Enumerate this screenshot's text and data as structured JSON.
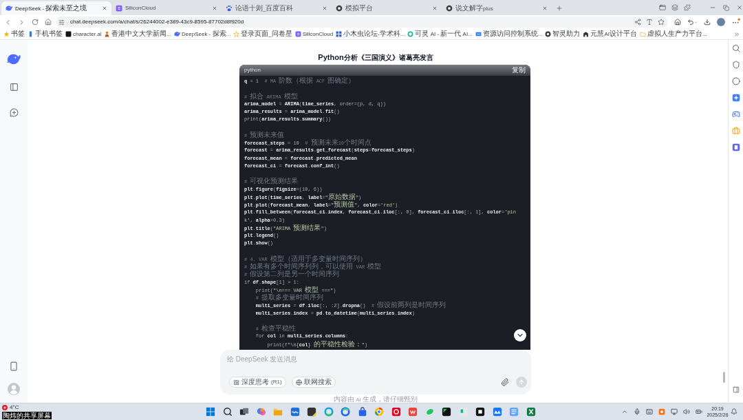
{
  "browser": {
    "tabs": [
      {
        "title": "DeepSeek - 探索未至之境",
        "selected": true
      },
      {
        "title": "SiliconCloud",
        "selected": false
      },
      {
        "title": "论语十则_百度百科",
        "selected": false
      },
      {
        "title": "模拟平台",
        "selected": false
      },
      {
        "title": "说文解字plus",
        "selected": false
      }
    ],
    "url": "chat.deepseek.com/a/chat/s/26244002-e389-43c9-8595-87702d8f920d",
    "bookmarks": [
      "书签",
      "手机书签",
      "character.ai",
      "香港中文大学新闻...",
      "DeepSeek - 探索...",
      "登录页面_问卷星",
      "SiliconCloud",
      "小木虫论坛-学术科...",
      "可灵 AI - 新一代 AI...",
      "资源访问控制系统...",
      "智灵助力",
      "元慧AI设计平台",
      "虚拟人生产力平台..."
    ]
  },
  "chat": {
    "title": "Python分析《三国演义》诸葛亮发言",
    "code_block": {
      "language": "python",
      "copy_label": "复制",
      "blocks": [
        [
          [
            {
              "kind": "name",
              "text": "q"
            },
            {
              "kind": "punct",
              "text": " = 1  "
            },
            {
              "kind": "comment",
              "text": "# MA 阶数（根据 ACF 图确定）"
            }
          ]
        ],
        [
          [
            {
              "kind": "comment",
              "text": "# 拟合 ARIMA 模型"
            }
          ],
          [
            {
              "kind": "name",
              "text": "arima_model"
            },
            {
              "kind": "punct",
              "text": " = "
            },
            {
              "kind": "name",
              "text": "ARIMA"
            },
            {
              "kind": "punct",
              "text": "("
            },
            {
              "kind": "name",
              "text": "time_series"
            },
            {
              "kind": "punct",
              "text": ", order=(p, d, q))"
            }
          ],
          [
            {
              "kind": "name",
              "text": "arima_results"
            },
            {
              "kind": "punct",
              "text": " = "
            },
            {
              "kind": "name",
              "text": "arima_model"
            },
            {
              "kind": "punct",
              "text": "."
            },
            {
              "kind": "name",
              "text": "fit"
            },
            {
              "kind": "punct",
              "text": "()"
            }
          ],
          [
            {
              "kind": "punct",
              "text": "print("
            },
            {
              "kind": "name",
              "text": "arima_results"
            },
            {
              "kind": "punct",
              "text": "."
            },
            {
              "kind": "name",
              "text": "summary"
            },
            {
              "kind": "punct",
              "text": "())"
            }
          ]
        ],
        [
          [
            {
              "kind": "comment",
              "text": "# 预测未来值"
            }
          ],
          [
            {
              "kind": "name",
              "text": "forecast_steps"
            },
            {
              "kind": "punct",
              "text": " = 10  "
            },
            {
              "kind": "comment",
              "text": "# 预测未来10个时间点"
            }
          ],
          [
            {
              "kind": "name",
              "text": "forecast"
            },
            {
              "kind": "punct",
              "text": " = "
            },
            {
              "kind": "name",
              "text": "arima_results"
            },
            {
              "kind": "punct",
              "text": "."
            },
            {
              "kind": "name",
              "text": "get_forecast"
            },
            {
              "kind": "punct",
              "text": "("
            },
            {
              "kind": "name",
              "text": "steps"
            },
            {
              "kind": "punct",
              "text": "="
            },
            {
              "kind": "name",
              "text": "forecast_steps"
            },
            {
              "kind": "punct",
              "text": ")"
            }
          ],
          [
            {
              "kind": "name",
              "text": "forecast_mean"
            },
            {
              "kind": "punct",
              "text": " = "
            },
            {
              "kind": "name",
              "text": "forecast"
            },
            {
              "kind": "punct",
              "text": "."
            },
            {
              "kind": "name",
              "text": "predicted_mean"
            }
          ],
          [
            {
              "kind": "name",
              "text": "forecast_ci"
            },
            {
              "kind": "punct",
              "text": " = "
            },
            {
              "kind": "name",
              "text": "forecast"
            },
            {
              "kind": "punct",
              "text": "."
            },
            {
              "kind": "name",
              "text": "conf_int"
            },
            {
              "kind": "punct",
              "text": "()"
            }
          ]
        ],
        [
          [
            {
              "kind": "comment",
              "text": "# 可视化预测结果"
            }
          ],
          [
            {
              "kind": "name",
              "text": "plt"
            },
            {
              "kind": "punct",
              "text": "."
            },
            {
              "kind": "name",
              "text": "figure"
            },
            {
              "kind": "punct",
              "text": "("
            },
            {
              "kind": "name",
              "text": "figsize"
            },
            {
              "kind": "punct",
              "text": "=(10, 6))"
            }
          ],
          [
            {
              "kind": "name",
              "text": "plt"
            },
            {
              "kind": "punct",
              "text": "."
            },
            {
              "kind": "name",
              "text": "plot"
            },
            {
              "kind": "punct",
              "text": "("
            },
            {
              "kind": "name",
              "text": "time_series"
            },
            {
              "kind": "punct",
              "text": ", "
            },
            {
              "kind": "name",
              "text": "label"
            },
            {
              "kind": "punct",
              "text": "="
            },
            {
              "kind": "string",
              "text": "\"原始数据\""
            },
            {
              "kind": "punct",
              "text": ")"
            }
          ],
          [
            {
              "kind": "name",
              "text": "plt"
            },
            {
              "kind": "punct",
              "text": "."
            },
            {
              "kind": "name",
              "text": "plot"
            },
            {
              "kind": "punct",
              "text": "("
            },
            {
              "kind": "name",
              "text": "forecast_mean"
            },
            {
              "kind": "punct",
              "text": ", "
            },
            {
              "kind": "name",
              "text": "label"
            },
            {
              "kind": "punct",
              "text": "="
            },
            {
              "kind": "string",
              "text": "\"预测值\""
            },
            {
              "kind": "punct",
              "text": ", "
            },
            {
              "kind": "name",
              "text": "color"
            },
            {
              "kind": "punct",
              "text": "="
            },
            {
              "kind": "string",
              "text": "'red'"
            },
            {
              "kind": "punct",
              "text": ")"
            }
          ],
          [
            {
              "kind": "name",
              "text": "plt"
            },
            {
              "kind": "punct",
              "text": "."
            },
            {
              "kind": "name",
              "text": "fill_between"
            },
            {
              "kind": "punct",
              "text": "("
            },
            {
              "kind": "name",
              "text": "forecast_ci"
            },
            {
              "kind": "punct",
              "text": "."
            },
            {
              "kind": "name",
              "text": "index"
            },
            {
              "kind": "punct",
              "text": ", "
            },
            {
              "kind": "name",
              "text": "forecast_ci"
            },
            {
              "kind": "punct",
              "text": "."
            },
            {
              "kind": "name",
              "text": "iloc"
            },
            {
              "kind": "punct",
              "text": "[:, 0], "
            },
            {
              "kind": "name",
              "text": "forecast_ci"
            },
            {
              "kind": "punct",
              "text": "."
            },
            {
              "kind": "name",
              "text": "iloc"
            },
            {
              "kind": "punct",
              "text": "[:, 1], "
            },
            {
              "kind": "name",
              "text": "color"
            },
            {
              "kind": "punct",
              "text": "="
            },
            {
              "kind": "string",
              "text": "'pin"
            }
          ],
          [
            {
              "kind": "string",
              "text": "k'"
            },
            {
              "kind": "punct",
              "text": ", "
            },
            {
              "kind": "name",
              "text": "alpha"
            },
            {
              "kind": "punct",
              "text": "=0.3)"
            }
          ],
          [
            {
              "kind": "name",
              "text": "plt"
            },
            {
              "kind": "punct",
              "text": "."
            },
            {
              "kind": "name",
              "text": "title"
            },
            {
              "kind": "punct",
              "text": "("
            },
            {
              "kind": "string",
              "text": "\"ARIMA 预测结果\""
            },
            {
              "kind": "punct",
              "text": ")"
            }
          ],
          [
            {
              "kind": "name",
              "text": "plt"
            },
            {
              "kind": "punct",
              "text": "."
            },
            {
              "kind": "name",
              "text": "legend"
            },
            {
              "kind": "punct",
              "text": "()"
            }
          ],
          [
            {
              "kind": "name",
              "text": "plt"
            },
            {
              "kind": "punct",
              "text": "."
            },
            {
              "kind": "name",
              "text": "show"
            },
            {
              "kind": "punct",
              "text": "()"
            }
          ]
        ],
        [
          [
            {
              "kind": "comment",
              "text": "# 4. VAR 模型（适用于多变量时间序列）"
            }
          ],
          [
            {
              "kind": "comment",
              "text": "# 如果有多个时间序列列，可以使用 VAR 模型"
            }
          ],
          [
            {
              "kind": "comment",
              "text": "# 假设第二列是另一个时间序列"
            }
          ],
          [
            {
              "kind": "punct",
              "text": "if "
            },
            {
              "kind": "name",
              "text": "df"
            },
            {
              "kind": "punct",
              "text": "."
            },
            {
              "kind": "name",
              "text": "shape"
            },
            {
              "kind": "punct",
              "text": "[1] > 1:"
            }
          ],
          [
            {
              "kind": "punct",
              "text": "    print("
            },
            {
              "kind": "string",
              "text": "\"\\n=== VAR 模型 ===\""
            },
            {
              "kind": "punct",
              "text": ")"
            }
          ],
          [
            {
              "kind": "comment",
              "text": "    # 提取多变量时间序列"
            }
          ],
          [
            {
              "kind": "name",
              "text": "    multi_series"
            },
            {
              "kind": "punct",
              "text": " = "
            },
            {
              "kind": "name",
              "text": "df"
            },
            {
              "kind": "punct",
              "text": "."
            },
            {
              "kind": "name",
              "text": "iloc"
            },
            {
              "kind": "punct",
              "text": "[:, :2]."
            },
            {
              "kind": "name",
              "text": "dropna"
            },
            {
              "kind": "punct",
              "text": "()  "
            },
            {
              "kind": "comment",
              "text": "# 假设前两列是时间序列"
            }
          ],
          [
            {
              "kind": "name",
              "text": "    multi_series"
            },
            {
              "kind": "punct",
              "text": "."
            },
            {
              "kind": "name",
              "text": "index"
            },
            {
              "kind": "punct",
              "text": " = "
            },
            {
              "kind": "name",
              "text": "pd"
            },
            {
              "kind": "punct",
              "text": "."
            },
            {
              "kind": "name",
              "text": "to_datetime"
            },
            {
              "kind": "punct",
              "text": "("
            },
            {
              "kind": "name",
              "text": "multi_series"
            },
            {
              "kind": "punct",
              "text": "."
            },
            {
              "kind": "name",
              "text": "index"
            },
            {
              "kind": "punct",
              "text": ")"
            }
          ]
        ],
        [
          [
            {
              "kind": "comment",
              "text": "    # 检查平稳性"
            }
          ],
          [
            {
              "kind": "punct",
              "text": "    for "
            },
            {
              "kind": "name",
              "text": "col"
            },
            {
              "kind": "punct",
              "text": " in "
            },
            {
              "kind": "name",
              "text": "multi_series"
            },
            {
              "kind": "punct",
              "text": "."
            },
            {
              "kind": "name",
              "text": "columns"
            },
            {
              "kind": "punct",
              "text": ":"
            }
          ],
          [
            {
              "kind": "punct",
              "text": "        print(f"
            },
            {
              "kind": "string",
              "text": "\"\\n{"
            },
            {
              "kind": "name",
              "text": "col"
            },
            {
              "kind": "string",
              "text": "} 的平稳性检验：\""
            },
            {
              "kind": "punct",
              "text": ")"
            }
          ]
        ]
      ]
    },
    "composer": {
      "placeholder": "给 DeepSeek 发送消息",
      "options": [
        {
          "label": "深度思考 (R1)",
          "selected": false
        },
        {
          "label": "联网搜索",
          "selected": false
        }
      ],
      "send_button": {
        "disabled": true
      }
    },
    "disclaimer": "内容由 AI 生成，请仔细甄别"
  },
  "taskbar": {
    "temperature": "4°C",
    "time": "20:19",
    "date": "2025/2/26"
  },
  "screen_share_label": "陶炜的共享屏幕"
}
